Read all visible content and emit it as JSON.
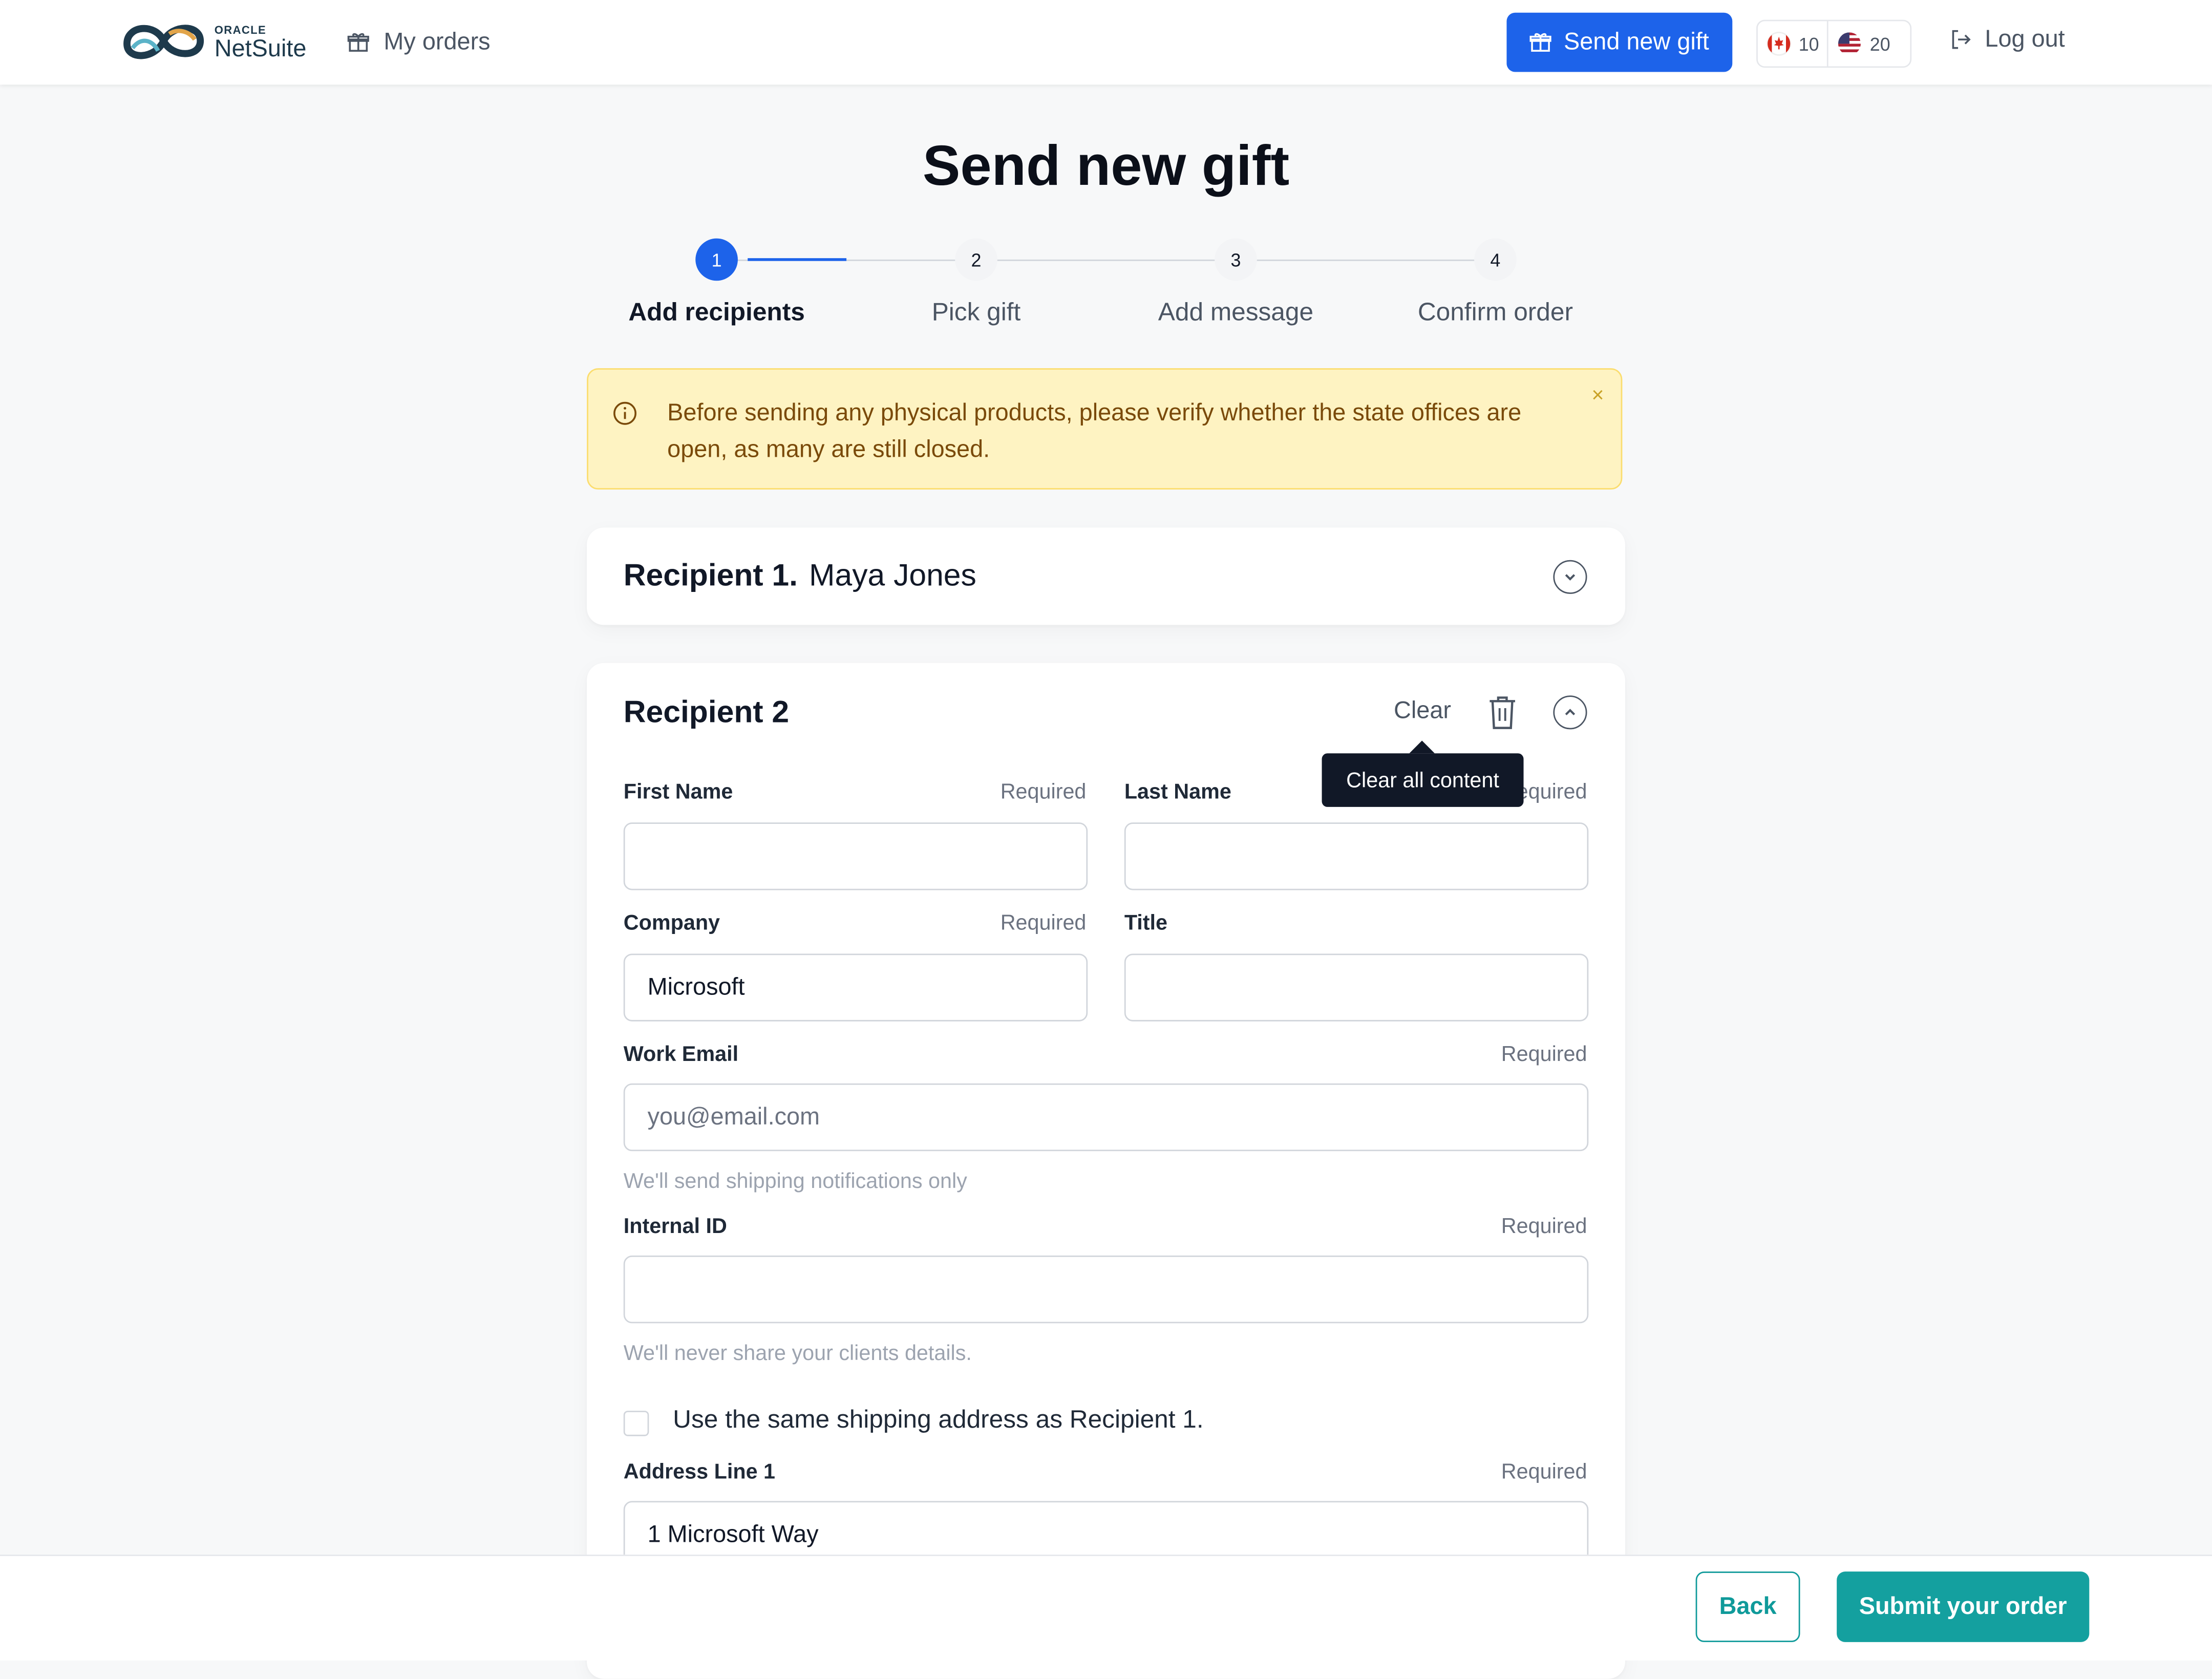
{
  "header": {
    "logo_oracle": "ORACLE",
    "logo_netsuite": "NetSuite",
    "nav_my_orders": "My orders",
    "send_button": "Send new gift",
    "flags": [
      {
        "country": "Canada",
        "count": "10"
      },
      {
        "country": "United States",
        "count": "20"
      }
    ],
    "logout": "Log out"
  },
  "page_title": "Send new gift",
  "stepper": {
    "steps": [
      {
        "number": "1",
        "label": "Add recipients",
        "active": true
      },
      {
        "number": "2",
        "label": "Pick gift",
        "active": false
      },
      {
        "number": "3",
        "label": "Add message",
        "active": false
      },
      {
        "number": "4",
        "label": "Confirm order",
        "active": false
      }
    ]
  },
  "alert": {
    "text": "Before sending any physical products, please verify whether the state offices are open, as many are still closed.",
    "close": "×"
  },
  "recipient1": {
    "label": "Recipient 1.",
    "name": "Maya Jones"
  },
  "recipient2": {
    "title": "Recipient 2",
    "clear": "Clear",
    "tooltip": "Clear all content",
    "fields": {
      "first_name": {
        "label": "First Name",
        "required": "Required",
        "value": ""
      },
      "last_name": {
        "label": "Last Name",
        "required": "Required",
        "value": ""
      },
      "company": {
        "label": "Company",
        "required": "Required",
        "value": "Microsoft"
      },
      "title": {
        "label": "Title",
        "value": ""
      },
      "work_email": {
        "label": "Work Email",
        "required": "Required",
        "placeholder": "you@email.com",
        "hint": "We'll send shipping notifications only"
      },
      "internal_id": {
        "label": "Internal ID",
        "required": "Required",
        "value": "",
        "hint": "We'll never share your clients details."
      },
      "same_address": {
        "label": "Use the same shipping address as Recipient 1.",
        "checked": false
      },
      "address1": {
        "label": "Address Line 1",
        "required": "Required",
        "value": "1 Microsoft Way"
      }
    }
  },
  "footer": {
    "back": "Back",
    "submit": "Submit your order"
  },
  "colors": {
    "primary_blue": "#1d63ea",
    "teal": "#14a09f",
    "alert_bg": "#fef3c2",
    "alert_text": "#7a4a0a"
  }
}
